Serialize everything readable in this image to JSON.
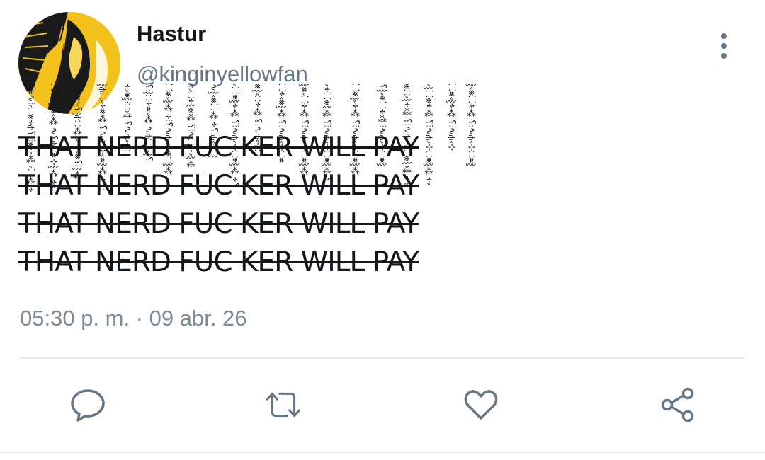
{
  "tweet": {
    "display_name": "Hastur",
    "handle": "@kinginyellowfan",
    "body_lines": [
      "THAT NERD FUC KER WILL PAY",
      "THAT NERD FUC KER WILL PAY",
      "THAT NERD FUC KER WILL PAY",
      "THAT NERD FUC KER WILL PAY"
    ],
    "timestamp": "05:30 p. m. · 09 abr. 26",
    "avatar_icon": "king-in-yellow-avatar",
    "more_icon": "more-vertical-icon"
  },
  "actions": [
    {
      "name": "reply",
      "icon": "reply-icon"
    },
    {
      "name": "retweet",
      "icon": "retweet-icon"
    },
    {
      "name": "like",
      "icon": "like-icon"
    },
    {
      "name": "share",
      "icon": "share-icon"
    }
  ],
  "colors": {
    "text": "#14171a",
    "secondary": "#657786",
    "avatar_bg": "#f2c11c",
    "divider": "#e6ecf0"
  }
}
